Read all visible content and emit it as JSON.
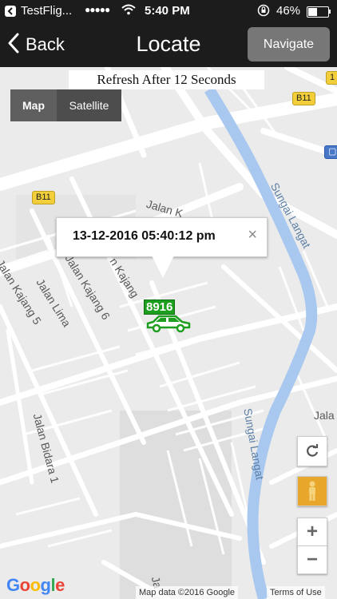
{
  "status_bar": {
    "carrier": "TestFlig...",
    "signal_dots": "●●●●●",
    "time": "5:40 PM",
    "battery": "46%",
    "battery_level": 0.46
  },
  "nav": {
    "back_label": "Back",
    "title": "Locate",
    "navigate_label": "Navigate"
  },
  "map": {
    "refresh_banner": "Refresh After 12 Seconds",
    "map_type": {
      "map_label": "Map",
      "satellite_label": "Satellite",
      "selected": "Map"
    },
    "info_window": {
      "text": "13-12-2016 05:40:12 pm",
      "close_symbol": "×"
    },
    "vehicle": {
      "plate": "8916",
      "icon": "car-icon",
      "color": "#1e9e1e"
    },
    "labels": {
      "jalan_k": "Jalan K",
      "jalan_kajang_5": "Jalan Kajang 5",
      "jalan_lima": "Jalan Lima",
      "jalan_kajang_6": "Jalan Kajang 6",
      "jalan_kajang": "n Kajang",
      "jalan_bidara_1": "Jalan Bidara 1",
      "sungai_langat_1": "Sungai Langat",
      "sungai_langat_2": "Sungai Langat",
      "jala": "Jala",
      "ja_bottom": "Ja",
      "road_b11_a": "B11",
      "road_b11_b": "B11",
      "road_1_a": "1",
      "road_1_b": "1"
    },
    "controls": {
      "zoom_in": "+",
      "zoom_out": "−"
    },
    "google_logo": "Google",
    "attribution": "Map data ©2016 Google",
    "terms": "Terms of Use"
  },
  "colors": {
    "navbar": "#1c1c1c",
    "river": "#a9c8ef",
    "road_badge": "#f2cf3a"
  }
}
